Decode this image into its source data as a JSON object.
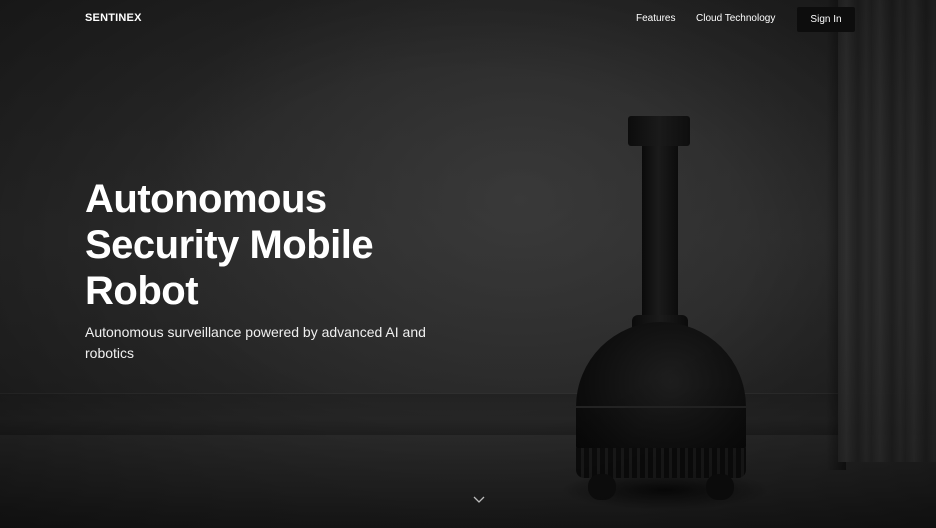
{
  "nav": {
    "logo": "SENTINEX",
    "links": [
      {
        "label": "Features"
      },
      {
        "label": "Cloud Technology"
      }
    ],
    "signin_label": "Sign In"
  },
  "hero": {
    "title_lines": [
      "Autonomous",
      "Security Mobile",
      "Robot"
    ],
    "subtitle": "Autonomous surveillance powered by advanced AI and robotics"
  },
  "icons": {
    "scroll": "chevron-down-icon"
  },
  "colors": {
    "background": "#242424",
    "text": "#ffffff",
    "button": "#0d0d0d"
  }
}
